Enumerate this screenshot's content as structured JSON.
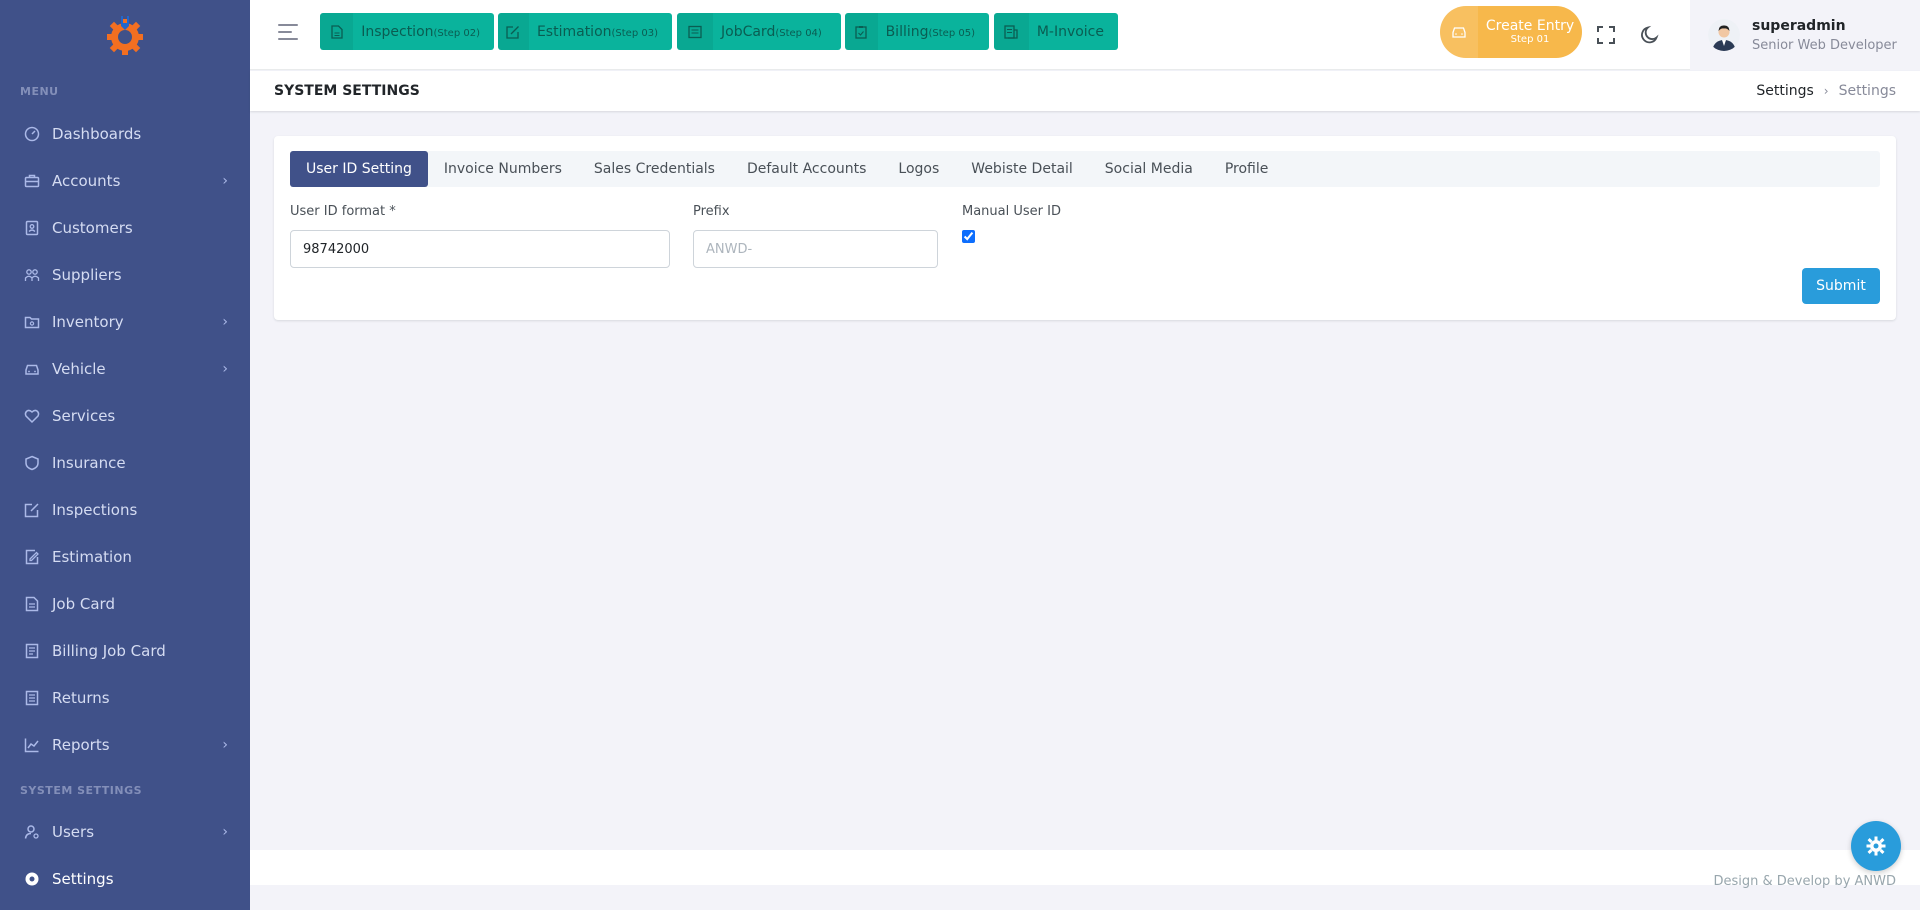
{
  "sidebar": {
    "menu_title": "MENU",
    "system_title": "SYSTEM SETTINGS",
    "items": [
      {
        "label": "Dashboards",
        "icon": "dashboard-icon",
        "has_submenu": false
      },
      {
        "label": "Accounts",
        "icon": "briefcase-icon",
        "has_submenu": true
      },
      {
        "label": "Customers",
        "icon": "contacts-book-icon",
        "has_submenu": false
      },
      {
        "label": "Suppliers",
        "icon": "group-icon",
        "has_submenu": false
      },
      {
        "label": "Inventory",
        "icon": "folder-icon",
        "has_submenu": true
      },
      {
        "label": "Vehicle",
        "icon": "car-icon",
        "has_submenu": true
      },
      {
        "label": "Services",
        "icon": "service-icon",
        "has_submenu": false
      },
      {
        "label": "Insurance",
        "icon": "shield-icon",
        "has_submenu": false
      },
      {
        "label": "Inspections",
        "icon": "edit-box-icon",
        "has_submenu": false
      },
      {
        "label": "Estimation",
        "icon": "draft-icon",
        "has_submenu": false
      },
      {
        "label": "Job Card",
        "icon": "file-icon",
        "has_submenu": false
      },
      {
        "label": "Billing Job Card",
        "icon": "bill-icon",
        "has_submenu": false
      },
      {
        "label": "Returns",
        "icon": "list-icon",
        "has_submenu": false
      },
      {
        "label": "Reports",
        "icon": "line-chart-icon",
        "has_submenu": true
      }
    ],
    "system_items": [
      {
        "label": "Users",
        "icon": "user-settings-icon",
        "has_submenu": true
      },
      {
        "label": "Settings",
        "icon": "settings-icon",
        "has_submenu": false,
        "active": true
      }
    ]
  },
  "topbar": {
    "quick_buttons": [
      {
        "label": "Inspection",
        "step": "(Step 02)",
        "icon": "file-icon"
      },
      {
        "label": "Estimation",
        "step": "(Step 03)",
        "icon": "edit-icon"
      },
      {
        "label": "JobCard",
        "step": "(Step 04)",
        "icon": "card-icon"
      },
      {
        "label": "Billing",
        "step": "(Step 05)",
        "icon": "clipboard-icon"
      },
      {
        "label": "M-Invoice",
        "step": "",
        "icon": "invoice-icon"
      }
    ],
    "create_entry": {
      "label": "Create Entry",
      "step": "Step 01"
    },
    "user": {
      "name": "superadmin",
      "role": "Senior Web Developer"
    }
  },
  "page": {
    "title": "SYSTEM SETTINGS",
    "breadcrumb": [
      "Settings",
      "Settings"
    ]
  },
  "tabs": [
    {
      "label": "User ID Setting",
      "active": true
    },
    {
      "label": "Invoice Numbers",
      "active": false
    },
    {
      "label": "Sales Credentials",
      "active": false
    },
    {
      "label": "Default Accounts",
      "active": false
    },
    {
      "label": "Logos",
      "active": false
    },
    {
      "label": "Webiste Detail",
      "active": false
    },
    {
      "label": "Social Media",
      "active": false
    },
    {
      "label": "Profile",
      "active": false
    }
  ],
  "form": {
    "user_id_format_label": "User ID format *",
    "user_id_format_value": "98742000",
    "prefix_label": "Prefix",
    "prefix_placeholder": "ANWD-",
    "manual_user_id_label": "Manual User ID",
    "manual_user_id_checked": true,
    "submit_label": "Submit"
  },
  "footer": {
    "text": "Design & Develop by ANWD"
  },
  "colors": {
    "sidebar_bg": "#405189",
    "quick_button": "#0ab39c",
    "create_entry": "#f7b84b",
    "submit": "#299cdb",
    "active_tab": "#405189"
  }
}
